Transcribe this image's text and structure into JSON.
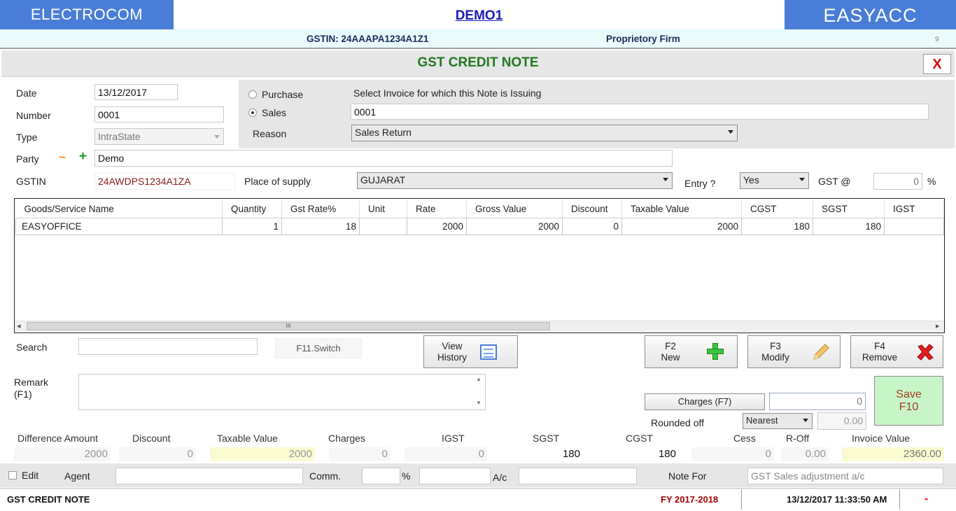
{
  "header": {
    "left_brand": "ELECTROCOM",
    "company": "DEMO1",
    "right_brand": "EASYACC",
    "gstin_label": "GSTIN: 24AAAPA1234A1Z1",
    "firm_type": "Proprietory Firm",
    "corner_num": "9"
  },
  "title": {
    "text": "GST CREDIT NOTE",
    "close": "X"
  },
  "form": {
    "date_label": "Date",
    "date_value": "13/12/2017",
    "number_label": "Number",
    "number_value": "0001",
    "type_label": "Type",
    "type_value": "IntraState",
    "party_label": "Party",
    "party_tilde": "~",
    "party_plus": "+",
    "party_value": "Demo",
    "gstin_label": "GSTIN",
    "gstin_value": "24AWDPS1234A1ZA",
    "pos_label": "Place of supply",
    "pos_value": "GUJARAT",
    "entry_label": "Entry ?",
    "entry_value": "Yes",
    "gst_label": "GST @",
    "gst_value": "0",
    "gst_pct": "%"
  },
  "invoice_panel": {
    "purchase_label": "Purchase",
    "sales_label": "Sales",
    "selected": "Sales",
    "select_label": "Select Invoice for which this Note is Issuing",
    "invoice_value": "0001",
    "reason_label": "Reason",
    "reason_value": "Sales Return"
  },
  "grid": {
    "columns": [
      "Goods/Service Name",
      "Quantity",
      "Gst Rate%",
      "Unit",
      "Rate",
      "Gross Value",
      "Discount",
      "Taxable Value",
      "CGST",
      "SGST",
      "IGST"
    ],
    "rows": [
      [
        "EASYOFFICE",
        "1",
        "18",
        "",
        "2000",
        "2000",
        "0",
        "2000",
        "180",
        "180",
        ""
      ]
    ],
    "scroll_grip": "III",
    "scroll_left": "◂",
    "scroll_right": "▸"
  },
  "toolbar": {
    "search_label": "Search",
    "search_value": "",
    "switch_label": "F11.Switch",
    "view_history_line1": "View",
    "view_history_line2": "History",
    "new_key": "F2",
    "new_label": "New",
    "modify_key": "F3",
    "modify_label": "Modify",
    "remove_key": "F4",
    "remove_label": "Remove"
  },
  "remark": {
    "label_line1": "Remark",
    "label_line2": "(F1)",
    "value": ""
  },
  "charges": {
    "charges_btn": "Charges (F7)",
    "charges_value": "0",
    "rounded_label": "Rounded off",
    "rounded_mode": "Nearest",
    "rounded_value": "0.00",
    "save_line1": "Save",
    "save_line2": "F10"
  },
  "summary": {
    "labels": [
      "Difference Amount",
      "Discount",
      "Taxable Value",
      "Charges",
      "IGST",
      "SGST",
      "CGST",
      "Cess",
      "R-Off",
      "Invoice Value"
    ],
    "values": [
      "2000",
      "0",
      "2000",
      "0",
      "0",
      "180",
      "180",
      "0",
      "0.00",
      "2360.00"
    ]
  },
  "footer": {
    "edit_label": "Edit",
    "agent_label": "Agent",
    "comm_label": "Comm.",
    "pct": "%",
    "ac_label": "A/c",
    "note_for_label": "Note For",
    "note_for_placeholder": "GST Sales adjustment a/c"
  },
  "status": {
    "module": "GST CREDIT NOTE",
    "fy": "FY 2017-2018",
    "datetime": "13/12/2017 11:33:50 AM",
    "min": "-"
  },
  "colors": {
    "brand_blue": "#4a7dd8",
    "title_green": "#1f7a1f",
    "highlight_yellow": "#fbfbd2",
    "save_green": "#c8f5c8",
    "status_red": "#a40000"
  }
}
